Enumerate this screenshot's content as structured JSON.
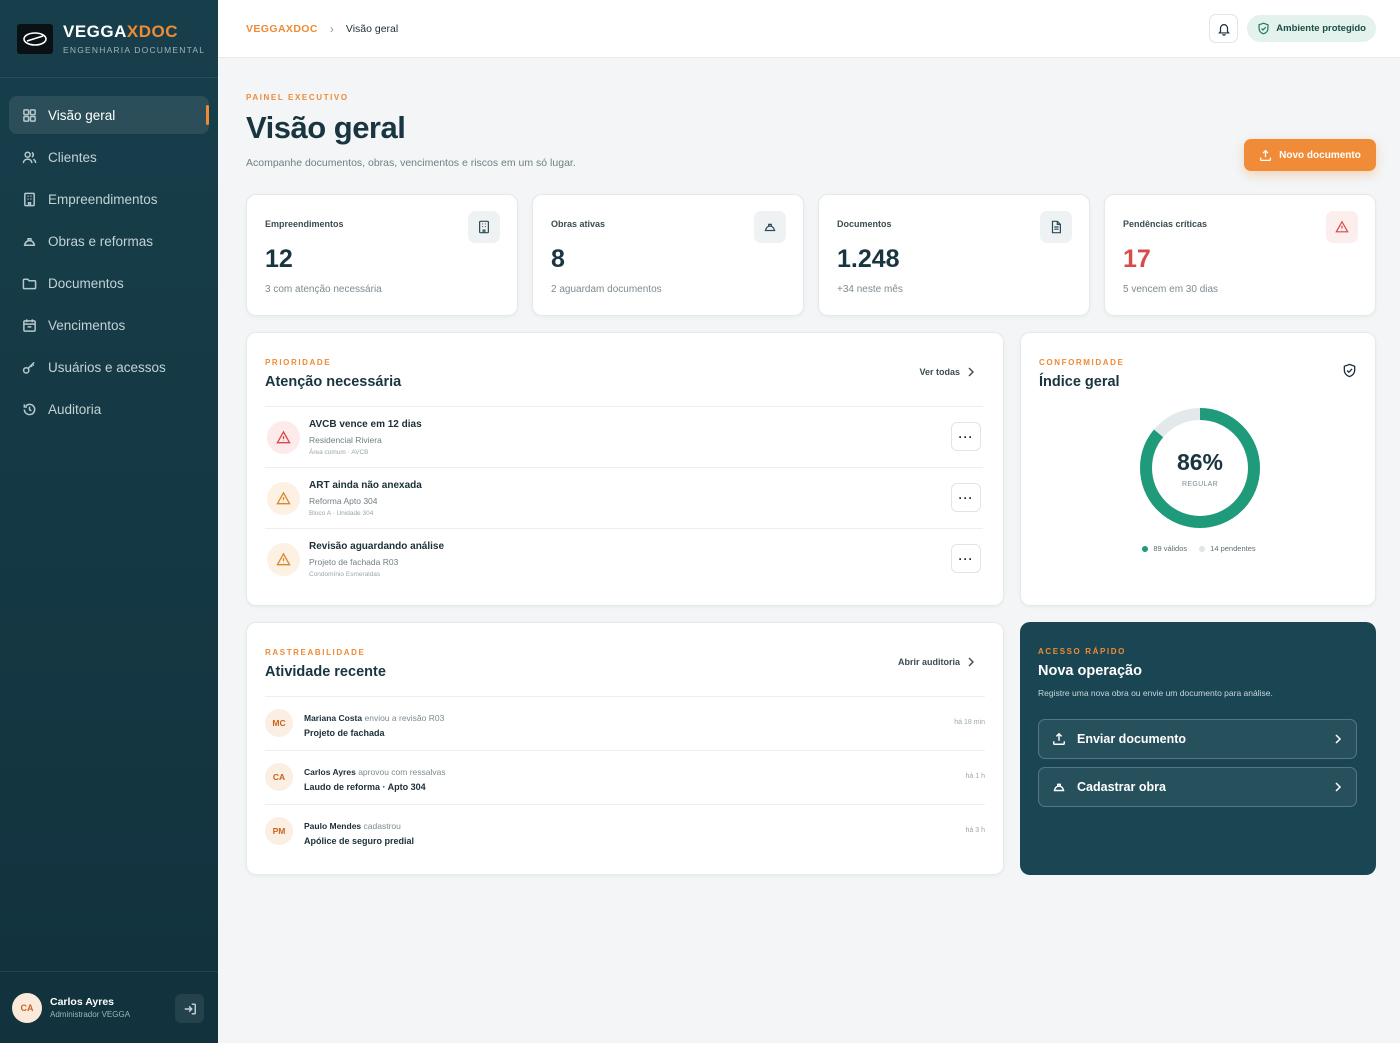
{
  "brand": {
    "name_main": "VEGGA",
    "name_accent": "XDOC",
    "subtitle": "ENGENHARIA DOCUMENTAL"
  },
  "sidebar": {
    "items": [
      {
        "label": "Visão geral",
        "icon": "grid-icon",
        "active": true
      },
      {
        "label": "Clientes",
        "icon": "users-icon"
      },
      {
        "label": "Empreendimentos",
        "icon": "building-icon"
      },
      {
        "label": "Obras e reformas",
        "icon": "hardhat-icon"
      },
      {
        "label": "Documentos",
        "icon": "folder-icon"
      },
      {
        "label": "Vencimentos",
        "icon": "calendar-icon"
      },
      {
        "label": "Usuários e acessos",
        "icon": "key-icon"
      },
      {
        "label": "Auditoria",
        "icon": "history-icon"
      }
    ],
    "user": {
      "initials": "CA",
      "name": "Carlos Ayres",
      "role": "Administrador VEGGA"
    }
  },
  "topbar": {
    "breadcrumb_root": "VEGGAXDOC",
    "breadcrumb_sep": "›",
    "breadcrumb_current": "Visão geral",
    "secure_label": "Ambiente protegido"
  },
  "header": {
    "eyebrow": "PAINEL EXECUTIVO",
    "title": "Visão geral",
    "subtitle": "Acompanhe documentos, obras, vencimentos e riscos em um só lugar.",
    "new_button": "Novo documento"
  },
  "stats": [
    {
      "label": "Empreendimentos",
      "value": "12",
      "note": "3 com atenção necessária",
      "icon": "building-icon"
    },
    {
      "label": "Obras ativas",
      "value": "8",
      "note": "2 aguardam documentos",
      "icon": "hardhat-icon"
    },
    {
      "label": "Documentos",
      "value": "1.248",
      "note": "+34 neste mês",
      "icon": "document-icon"
    },
    {
      "label": "Pendências críticas",
      "value": "17",
      "note": "5 vencem em 30 dias",
      "icon": "warning-icon"
    }
  ],
  "priority": {
    "eyebrow": "PRIORIDADE",
    "title": "Atenção necessária",
    "link": "Ver todas",
    "items": [
      {
        "title": "AVCB vence em 12 dias",
        "sub": "Residencial Riviera",
        "meta": "Área comum · AVCB",
        "level": "red"
      },
      {
        "title": "ART ainda não anexada",
        "sub": "Reforma Apto 304",
        "meta": "Bloco A · Unidade 304",
        "level": "amber"
      },
      {
        "title": "Revisão aguardando análise",
        "sub": "Projeto de fachada R03",
        "meta": "Condomínio Esmeraldas",
        "level": "amber"
      }
    ]
  },
  "compliance": {
    "eyebrow": "CONFORMIDADE",
    "title": "Índice geral",
    "percent": 86,
    "value_text": "86%",
    "status": "REGULAR",
    "legend": [
      {
        "label": "89 válidos",
        "color": "#1f9a7a"
      },
      {
        "label": "14 pendentes",
        "color": "#dfe5e8"
      }
    ]
  },
  "activity": {
    "eyebrow": "RASTREABILIDADE",
    "title": "Atividade recente",
    "link": "Abrir auditoria",
    "items": [
      {
        "initials": "MC",
        "name": "Mariana Costa",
        "action": "enviou a revisão R03",
        "target": "Projeto de fachada",
        "time": "há 18 min"
      },
      {
        "initials": "CA",
        "name": "Carlos Ayres",
        "action": "aprovou com ressalvas",
        "target": "Laudo de reforma · Apto 304",
        "time": "há 1 h"
      },
      {
        "initials": "PM",
        "name": "Paulo Mendes",
        "action": "cadastrou",
        "target": "Apólice de seguro predial",
        "time": "há 3 h"
      }
    ]
  },
  "quick": {
    "eyebrow": "ACESSO RÁPIDO",
    "title": "Nova operação",
    "subtitle": "Registre uma nova obra ou envie um documento para análise.",
    "buttons": [
      {
        "label": "Enviar documento",
        "icon": "upload-icon"
      },
      {
        "label": "Cadastrar obra",
        "icon": "hardhat-icon"
      }
    ]
  },
  "colors": {
    "accent": "#ef8a35",
    "sidebar": "#173f4b",
    "success": "#1f9a7a",
    "danger": "#d64b4b"
  }
}
